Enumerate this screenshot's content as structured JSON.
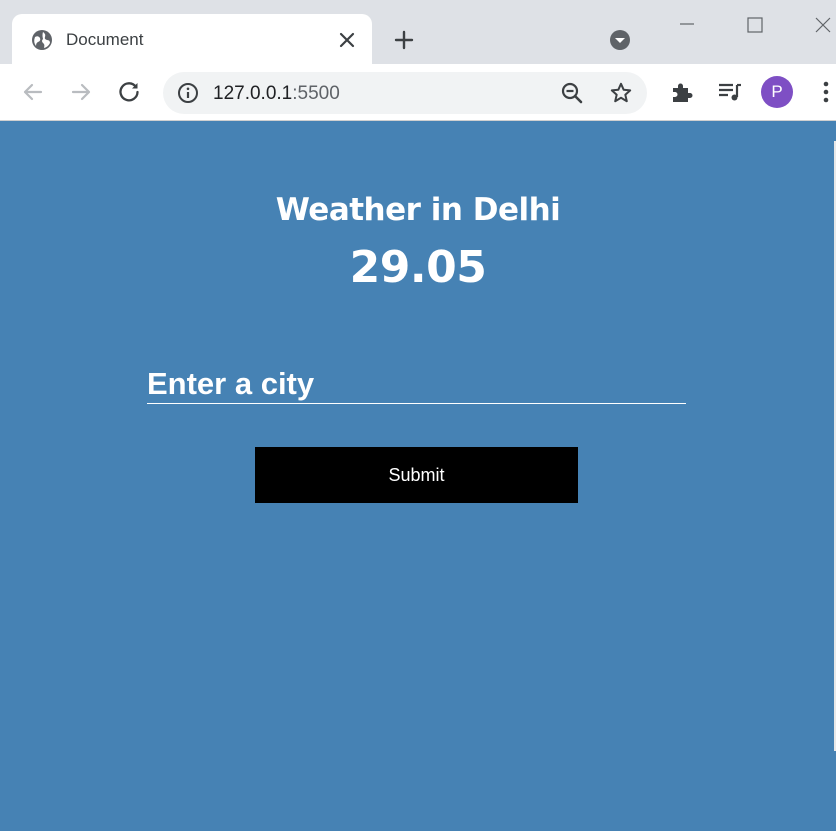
{
  "browser": {
    "tab": {
      "title": "Document",
      "favicon": "globe-icon",
      "close_icon": "close-icon"
    },
    "new_tab_icon": "plus-icon",
    "tab_search_icon": "chevron-down-circle-icon",
    "window_controls": [
      "minimize-icon",
      "maximize-icon",
      "close-icon"
    ],
    "toolbar": {
      "back_icon": "arrow-left-icon",
      "forward_icon": "arrow-right-icon",
      "reload_icon": "reload-icon",
      "url_host": "127.0.0.1",
      "url_port": ":5500",
      "site_info_icon": "info-icon",
      "zoom_icon": "zoom-out-icon",
      "bookmark_icon": "star-icon",
      "extensions_icon": "puzzle-icon",
      "media_icon": "playlist-icon",
      "profile_initial": "P",
      "menu_icon": "kebab-menu-icon"
    }
  },
  "page": {
    "heading": "Weather in Delhi",
    "temperature": "29.05",
    "city_input": {
      "placeholder": "Enter a city",
      "value": ""
    },
    "submit_label": "Submit"
  },
  "colors": {
    "page_background": "#4682b4",
    "button_background": "#000000",
    "avatar": "#7e4fc4",
    "tabstrip": "#dee1e6"
  }
}
